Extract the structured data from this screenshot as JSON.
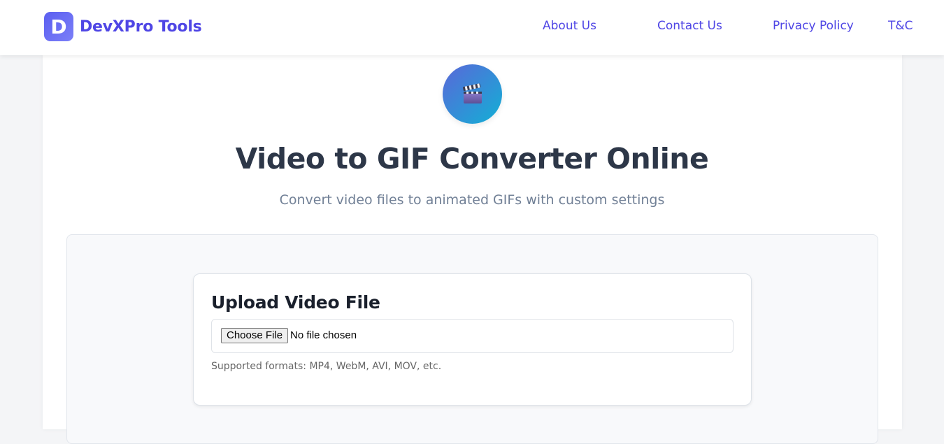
{
  "header": {
    "brand_letter": "D",
    "brand_name": "DevXPro Tools",
    "nav": [
      {
        "label": "About Us"
      },
      {
        "label": "Contact Us"
      },
      {
        "label": "Privacy Policy"
      },
      {
        "label": "T&C"
      }
    ]
  },
  "hero": {
    "icon": "clapper-board-icon",
    "title": "Video to GIF Converter Online",
    "subtitle": "Convert video files to animated GIFs with custom settings"
  },
  "upload": {
    "heading": "Upload Video File",
    "button_label": "Choose File",
    "status": "No file chosen",
    "help": "Supported formats: MP4, WebM, AVI, MOV, etc."
  },
  "colors": {
    "brand": "#4f46e5",
    "icon_gradient_start": "#5a67d8",
    "icon_gradient_end": "#12b0d6"
  }
}
